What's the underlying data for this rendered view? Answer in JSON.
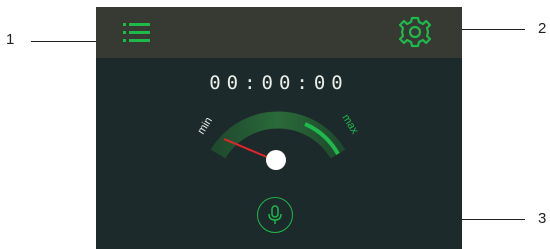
{
  "callouts": {
    "c1": "1",
    "c2": "2",
    "c3": "3"
  },
  "header": {
    "menu_icon": "list-menu-icon",
    "settings_icon": "gear-icon"
  },
  "timer": {
    "value": "00:00:00"
  },
  "gauge": {
    "min_label": "min",
    "max_label": "max",
    "level": 0.05,
    "accent": "#1fb84b"
  },
  "mic": {
    "icon": "microphone-icon"
  },
  "colors": {
    "screen_bg": "#1c2a2b",
    "header_bg": "#363a32",
    "accent": "#1fb84b",
    "needle": "#e0262b"
  }
}
